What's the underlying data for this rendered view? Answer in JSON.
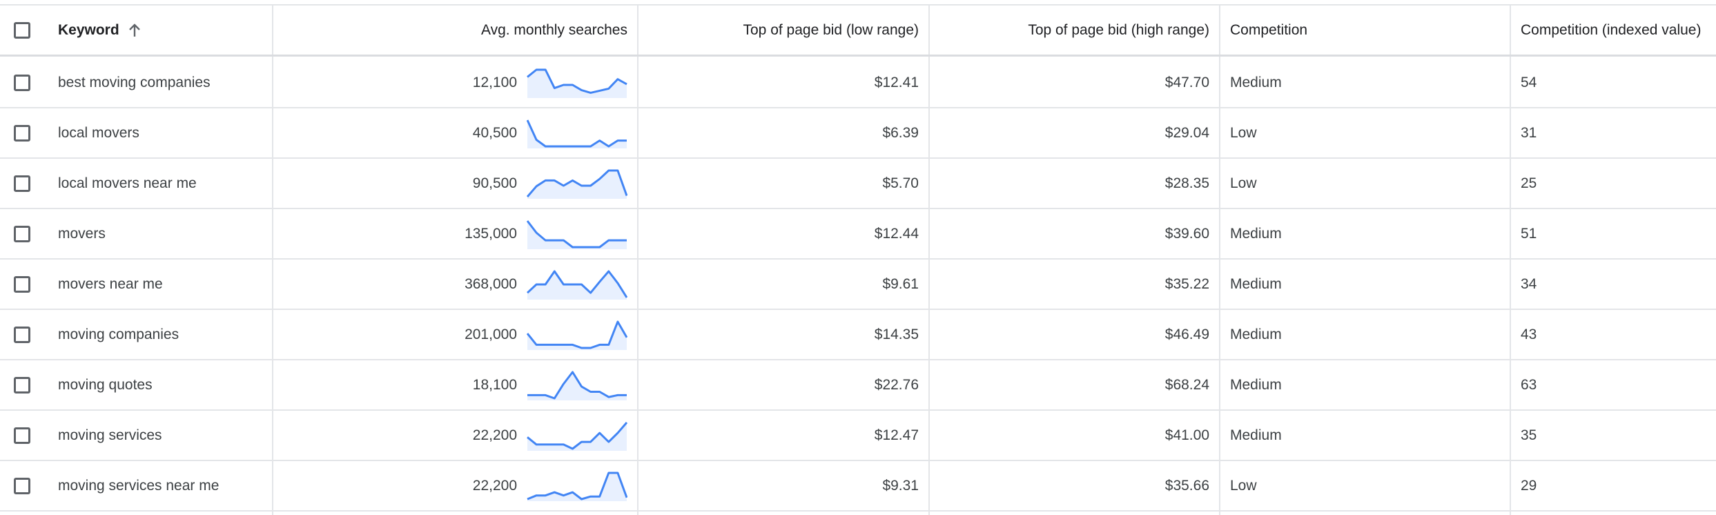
{
  "header": {
    "keyword": "Keyword",
    "avg_monthly_searches": "Avg. monthly searches",
    "bid_low": "Top of page bid (low range)",
    "bid_high": "Top of page bid (high range)",
    "competition": "Competition",
    "competition_index": "Competition (indexed value)"
  },
  "accent_color": "#4285f4",
  "sort": {
    "column": "keyword",
    "direction": "ascending",
    "icon": "arrow-up-icon"
  },
  "rows": [
    {
      "keyword": "best moving companies",
      "searches": "12,100",
      "bid_low": "$12.41",
      "bid_high": "$47.70",
      "competition": "Medium",
      "competition_index": "54",
      "trend": [
        0.72,
        1.0,
        1.0,
        0.3,
        0.42,
        0.42,
        0.22,
        0.12,
        0.2,
        0.28,
        0.64,
        0.45
      ]
    },
    {
      "keyword": "local movers",
      "searches": "40,500",
      "bid_low": "$6.39",
      "bid_high": "$29.04",
      "competition": "Low",
      "competition_index": "31",
      "trend": [
        1.0,
        0.25,
        0.0,
        0.0,
        0.0,
        0.0,
        0.0,
        0.0,
        0.22,
        0.0,
        0.22,
        0.22
      ]
    },
    {
      "keyword": "local movers near me",
      "searches": "90,500",
      "bid_low": "$5.70",
      "bid_high": "$28.35",
      "competition": "Low",
      "competition_index": "25",
      "trend": [
        0.0,
        0.4,
        0.62,
        0.62,
        0.42,
        0.62,
        0.42,
        0.42,
        0.68,
        1.0,
        1.0,
        0.04
      ]
    },
    {
      "keyword": "movers",
      "searches": "135,000",
      "bid_low": "$12.44",
      "bid_high": "$39.60",
      "competition": "Medium",
      "competition_index": "51",
      "trend": [
        1.0,
        0.55,
        0.26,
        0.26,
        0.26,
        0.0,
        0.0,
        0.0,
        0.0,
        0.26,
        0.26,
        0.26
      ]
    },
    {
      "keyword": "movers near me",
      "searches": "368,000",
      "bid_low": "$9.61",
      "bid_high": "$35.22",
      "competition": "Medium",
      "competition_index": "34",
      "trend": [
        0.18,
        0.5,
        0.5,
        1.0,
        0.5,
        0.5,
        0.5,
        0.18,
        0.6,
        1.0,
        0.55,
        0.0
      ]
    },
    {
      "keyword": "moving companies",
      "searches": "201,000",
      "bid_low": "$14.35",
      "bid_high": "$46.49",
      "competition": "Medium",
      "competition_index": "43",
      "trend": [
        0.55,
        0.12,
        0.12,
        0.12,
        0.12,
        0.12,
        0.0,
        0.0,
        0.12,
        0.12,
        1.0,
        0.4
      ]
    },
    {
      "keyword": "moving quotes",
      "searches": "18,100",
      "bid_low": "$22.76",
      "bid_high": "$68.24",
      "competition": "Medium",
      "competition_index": "63",
      "trend": [
        0.12,
        0.12,
        0.12,
        0.0,
        0.55,
        1.0,
        0.45,
        0.25,
        0.25,
        0.05,
        0.12,
        0.12
      ]
    },
    {
      "keyword": "moving services",
      "searches": "22,200",
      "bid_low": "$12.47",
      "bid_high": "$41.00",
      "competition": "Medium",
      "competition_index": "35",
      "trend": [
        0.44,
        0.16,
        0.16,
        0.16,
        0.16,
        0.0,
        0.26,
        0.26,
        0.6,
        0.26,
        0.6,
        1.0
      ]
    },
    {
      "keyword": "moving services near me",
      "searches": "22,200",
      "bid_low": "$9.31",
      "bid_high": "$35.66",
      "competition": "Low",
      "competition_index": "29",
      "trend": [
        0.0,
        0.14,
        0.14,
        0.26,
        0.14,
        0.26,
        0.0,
        0.1,
        0.1,
        1.0,
        1.0,
        0.06
      ]
    }
  ]
}
